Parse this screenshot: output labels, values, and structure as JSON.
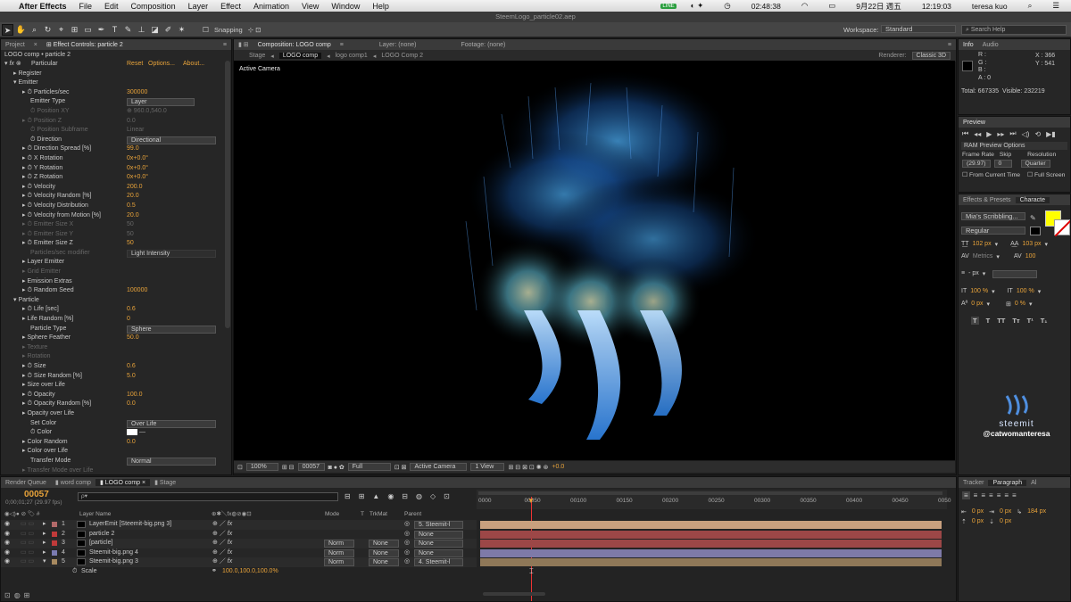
{
  "menubar": {
    "app": "After Effects",
    "items": [
      "File",
      "Edit",
      "Composition",
      "Layer",
      "Effect",
      "Animation",
      "View",
      "Window",
      "Help"
    ],
    "status": {
      "time1": "02:48:38",
      "date": "9月22日 週五",
      "time2": "12:19:03",
      "user": "teresa kuo"
    }
  },
  "window_title": "SteemLogo_particle02.aep",
  "toolbar": {
    "snapping": "Snapping",
    "workspace_label": "Workspace:",
    "workspace_value": "Standard",
    "search": "Search Help"
  },
  "left_panel": {
    "tab_project": "Project",
    "tab_effect": "Effect Controls: particle 2",
    "breadcrumb": "LOGO comp • particle 2",
    "effect_name": "Particular",
    "reset": "Reset",
    "options": "Options...",
    "about": "About...",
    "rows": [
      {
        "n": "▸ Register",
        "d": 0,
        "v": "",
        "t": ""
      },
      {
        "n": "▾ Emitter",
        "d": 0,
        "v": "",
        "t": ""
      },
      {
        "n": "▸ ⏱ Particles/sec",
        "d": 1,
        "v": "300000",
        "t": "o"
      },
      {
        "n": "Emitter Type",
        "d": 2,
        "v": "Layer",
        "t": "dd"
      },
      {
        "n": "⏱ Position XY",
        "d": 2,
        "v": "⊕ 960.0,540.0",
        "t": "dis"
      },
      {
        "n": "▸ ⏱ Position Z",
        "d": 1,
        "v": "0.0",
        "t": "dis"
      },
      {
        "n": "⏱ Position Subframe",
        "d": 2,
        "v": "Linear",
        "t": "dis"
      },
      {
        "n": "⏱ Direction",
        "d": 2,
        "v": "Directional",
        "t": "dd"
      },
      {
        "n": "▸ ⏱ Direction Spread [%]",
        "d": 1,
        "v": "99.0",
        "t": "o"
      },
      {
        "n": "▸ ⏱ X Rotation",
        "d": 1,
        "v": "0x+0.0°",
        "t": "o"
      },
      {
        "n": "▸ ⏱ Y Rotation",
        "d": 1,
        "v": "0x+0.0°",
        "t": "o"
      },
      {
        "n": "▸ ⏱ Z Rotation",
        "d": 1,
        "v": "0x+0.0°",
        "t": "o"
      },
      {
        "n": "▸ ⏱ Velocity",
        "d": 1,
        "v": "200.0",
        "t": "o"
      },
      {
        "n": "▸ ⏱ Velocity Random [%]",
        "d": 1,
        "v": "20.0",
        "t": "o"
      },
      {
        "n": "▸ ⏱ Velocity Distribution",
        "d": 1,
        "v": "0.5",
        "t": "o"
      },
      {
        "n": "▸ ⏱ Velocity from Motion [%]",
        "d": 1,
        "v": "20.0",
        "t": "o"
      },
      {
        "n": "▸ ⏱ Emitter Size X",
        "d": 1,
        "v": "50",
        "t": "dis"
      },
      {
        "n": "▸ ⏱ Emitter Size Y",
        "d": 1,
        "v": "50",
        "t": "dis"
      },
      {
        "n": "▸ ⏱ Emitter Size Z",
        "d": 1,
        "v": "50",
        "t": "o"
      },
      {
        "n": "Particles/sec modifier",
        "d": 2,
        "v": "Light Intensity",
        "t": "disdd"
      },
      {
        "n": "▸ Layer Emitter",
        "d": 1,
        "v": "",
        "t": ""
      },
      {
        "n": "▸ Grid Emitter",
        "d": 1,
        "v": "",
        "t": "dis"
      },
      {
        "n": "▸ Emission Extras",
        "d": 1,
        "v": "",
        "t": ""
      },
      {
        "n": "▸ ⏱ Random Seed",
        "d": 1,
        "v": "100000",
        "t": "o"
      },
      {
        "n": "▾ Particle",
        "d": 0,
        "v": "",
        "t": ""
      },
      {
        "n": "▸ ⏱ Life [sec]",
        "d": 1,
        "v": "0.6",
        "t": "o"
      },
      {
        "n": "▸ Life Random [%]",
        "d": 1,
        "v": "0",
        "t": "o"
      },
      {
        "n": "Particle Type",
        "d": 2,
        "v": "Sphere",
        "t": "dd"
      },
      {
        "n": "▸ Sphere Feather",
        "d": 1,
        "v": "50.0",
        "t": "o"
      },
      {
        "n": "▸ Texture",
        "d": 1,
        "v": "",
        "t": "dis"
      },
      {
        "n": "▸ Rotation",
        "d": 1,
        "v": "",
        "t": "dis"
      },
      {
        "n": "▸ ⏱ Size",
        "d": 1,
        "v": "0.6",
        "t": "o"
      },
      {
        "n": "▸ ⏱ Size Random [%]",
        "d": 1,
        "v": "5.0",
        "t": "o"
      },
      {
        "n": "▸ Size over Life",
        "d": 1,
        "v": "",
        "t": ""
      },
      {
        "n": "▸ ⏱ Opacity",
        "d": 1,
        "v": "100.0",
        "t": "o"
      },
      {
        "n": "▸ ⏱ Opacity Random [%]",
        "d": 1,
        "v": "0.0",
        "t": "o"
      },
      {
        "n": "▸ Opacity over Life",
        "d": 1,
        "v": "",
        "t": ""
      },
      {
        "n": "Set Color",
        "d": 2,
        "v": "Over Life",
        "t": "dd"
      },
      {
        "n": "⏱ Color",
        "d": 2,
        "v": "",
        "t": "color"
      },
      {
        "n": "▸ Color Random",
        "d": 1,
        "v": "0.0",
        "t": "o"
      },
      {
        "n": "▸ Color over Life",
        "d": 1,
        "v": "",
        "t": ""
      },
      {
        "n": "Transfer Mode",
        "d": 2,
        "v": "Normal",
        "t": "dd"
      },
      {
        "n": "▸ Transfer Mode over Life",
        "d": 1,
        "v": "",
        "t": "dis"
      }
    ]
  },
  "comp_panel": {
    "tab_comp": "Composition: LOGO comp",
    "tab_layer": "Layer: (none)",
    "tab_footage": "Footage: (none)",
    "crumbs": [
      "Stage",
      "LOGO comp",
      "logo comp1",
      "LOGO Comp 2"
    ],
    "renderer_label": "Renderer:",
    "renderer_value": "Classic 3D",
    "camera_label": "Active Camera",
    "footer": {
      "zoom": "100%",
      "frame": "00057",
      "res": "Full",
      "camera": "Active Camera",
      "view": "1 View",
      "exposure": "+0.0"
    }
  },
  "info_panel": {
    "tab_info": "Info",
    "tab_audio": "Audio",
    "r": "R :",
    "g": "G :",
    "b": "B :",
    "a": "A : 0",
    "x": "X : 366",
    "y": "Y : 541",
    "total": "Total: 667335",
    "visible": "Visible: 232219"
  },
  "preview_panel": {
    "tab": "Preview",
    "ram": "RAM Preview Options",
    "frame_rate_label": "Frame Rate",
    "skip_label": "Skip",
    "resolution_label": "Resolution",
    "frame_rate": "(29.97)",
    "skip": "0",
    "resolution": "Quarter",
    "from_current": "From Current Time",
    "full_screen": "Full Screen"
  },
  "character_panel": {
    "tab_effects": "Effects & Presets",
    "tab_char": "Characte",
    "font": "Mia's Scribbling...",
    "style": "Regular",
    "size": "102 px",
    "leading": "103 px",
    "kerning": "Metrics",
    "tracking": "100",
    "stroke": "- px",
    "vscale": "100 %",
    "hscale": "100 %",
    "baseline": "0 px",
    "tsume": "0 %",
    "fill_color": "#ffff00",
    "faux": [
      "T",
      "T",
      "TT",
      "Tт",
      "T¹",
      "T₁"
    ]
  },
  "watermark": {
    "text1": "steemit",
    "text2": "@catwomanteresa"
  },
  "timeline": {
    "tabs": [
      "Render Queue",
      "word comp",
      "LOGO comp",
      "Stage"
    ],
    "timecode": "00057",
    "timecode_sub": "0;00;01;27 (29.97 fps)",
    "search_placeholder": "ρ▾",
    "col_layer": "Layer Name",
    "col_mode": "Mode",
    "col_t": "T",
    "col_trkmat": "TrkMat",
    "col_parent": "Parent",
    "ruler": [
      "0000",
      "00050",
      "00100",
      "00150",
      "00200",
      "00250",
      "00300",
      "00350",
      "00400",
      "00450",
      "0050"
    ],
    "layers": [
      {
        "num": "1",
        "name": "LayerEmit [Steemit-big.png 3]",
        "mode": "",
        "trk": "",
        "parent": "5. Steemit-l",
        "color": "#b36a6a",
        "bar": "#c9a07e"
      },
      {
        "num": "2",
        "name": "particle 2",
        "mode": "",
        "trk": "",
        "parent": "None",
        "color": "#c03a3a",
        "bar": "#9c4747"
      },
      {
        "num": "3",
        "name": "[particle]",
        "mode": "Norm",
        "trk": "None",
        "parent": "None",
        "color": "#c03a3a",
        "bar": "#9c4747"
      },
      {
        "num": "4",
        "name": "Steemit-big.png 4",
        "mode": "Norm",
        "trk": "None",
        "parent": "None",
        "color": "#7b7bb0",
        "bar": "#7e7aa8"
      },
      {
        "num": "5",
        "name": "Steemit-big.png 3",
        "mode": "Norm",
        "trk": "None",
        "parent": "4. Steemit-l",
        "color": "#a88a60",
        "bar": "#8f7858"
      }
    ],
    "scale_label": "Scale",
    "scale_value": "100.0,100.0,100.0%"
  },
  "right_bottom": {
    "tab_tracker": "Tracker",
    "tab_paragraph": "Paragraph",
    "tab_al": "Al",
    "indent1": "0 px",
    "indent2": "0 px",
    "indent3": "184 px",
    "space1": "0 px",
    "space2": "0 px"
  }
}
